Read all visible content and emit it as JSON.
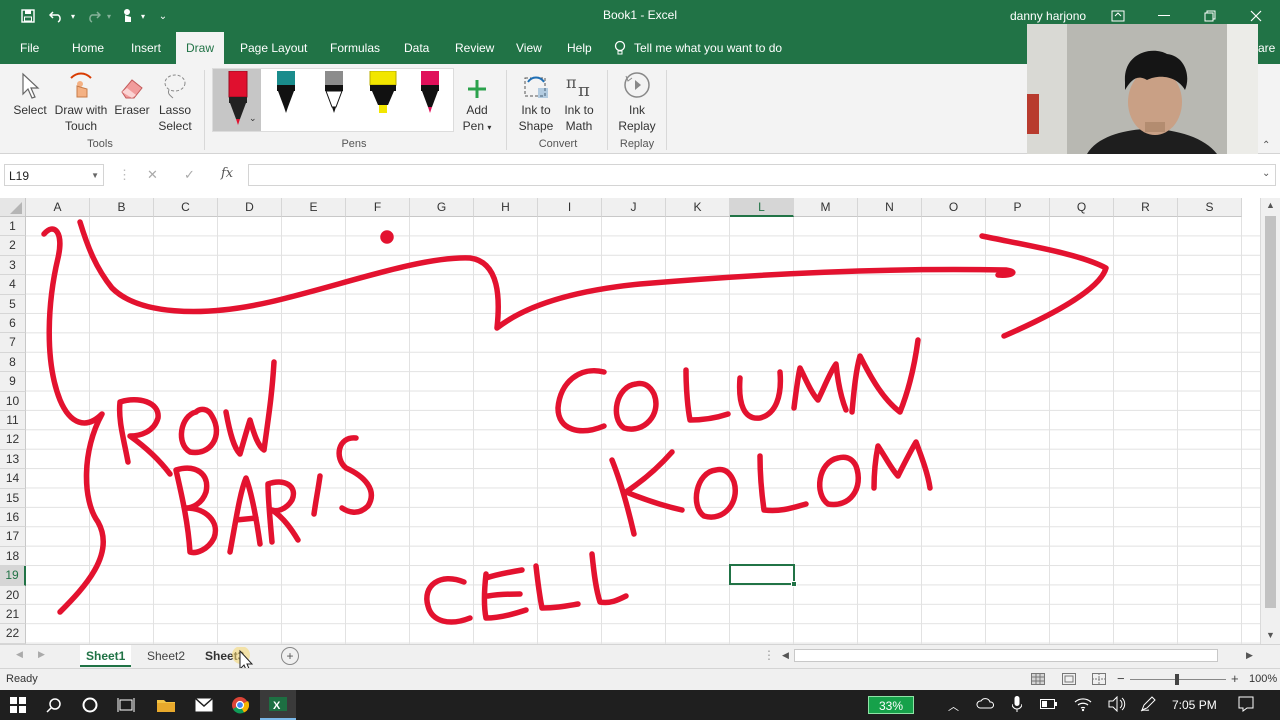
{
  "window": {
    "title": "Book1  -  Excel",
    "user": "danny harjono"
  },
  "ribbon_tabs": [
    {
      "label": "File"
    },
    {
      "label": "Home"
    },
    {
      "label": "Insert"
    },
    {
      "label": "Draw",
      "active": true
    },
    {
      "label": "Page Layout"
    },
    {
      "label": "Formulas"
    },
    {
      "label": "Data"
    },
    {
      "label": "Review"
    },
    {
      "label": "View"
    },
    {
      "label": "Help"
    }
  ],
  "tell_me": "Tell me what you want to do",
  "share_partial": "are",
  "ribbon": {
    "tools": {
      "select": "Select",
      "draw_with_touch_1": "Draw with",
      "draw_with_touch_2": "Touch",
      "eraser": "Eraser",
      "lasso_1": "Lasso",
      "lasso_2": "Select",
      "group": "Tools"
    },
    "pens": {
      "group": "Pens",
      "items": [
        {
          "color": "#e0102f",
          "tip": "#111"
        },
        {
          "color": "#111111",
          "tip": "#1a8c8c"
        },
        {
          "color": "#111111",
          "tip": "#8c8c8c"
        },
        {
          "color": "#f2e600",
          "tip": "#f2e600"
        },
        {
          "color": "#e0105a",
          "tip": "#e0105a"
        }
      ],
      "add_1": "Add",
      "add_2": "Pen"
    },
    "convert": {
      "ink_shape_1": "Ink to",
      "ink_shape_2": "Shape",
      "ink_math_1": "Ink to",
      "ink_math_2": "Math",
      "group": "Convert"
    },
    "replay": {
      "label_1": "Ink",
      "label_2": "Replay",
      "group": "Replay"
    }
  },
  "formula_bar": {
    "name_box": "L19",
    "fx": "fx",
    "value": ""
  },
  "grid": {
    "columns": [
      "A",
      "B",
      "C",
      "D",
      "E",
      "F",
      "G",
      "H",
      "I",
      "J",
      "K",
      "L",
      "M",
      "N",
      "O",
      "P",
      "Q",
      "R",
      "S"
    ],
    "rows": [
      "1",
      "2",
      "3",
      "4",
      "5",
      "6",
      "7",
      "8",
      "9",
      "10",
      "11",
      "12",
      "13",
      "14",
      "15",
      "16",
      "17",
      "18",
      "19",
      "20",
      "21",
      "22"
    ],
    "selected_column": "L",
    "selected_row": "19"
  },
  "ink_annotations": [
    "ROW",
    "BARIS",
    "COLUMN",
    "KOLOM",
    "CELL"
  ],
  "ink_color": "#e3122f",
  "sheets": [
    {
      "label": "Sheet1",
      "active": true
    },
    {
      "label": "Sheet2"
    },
    {
      "label": "Sheet3"
    }
  ],
  "status": {
    "ready": "Ready",
    "zoom": "100%"
  },
  "taskbar": {
    "battery": "33%",
    "time": "7:05 PM"
  }
}
